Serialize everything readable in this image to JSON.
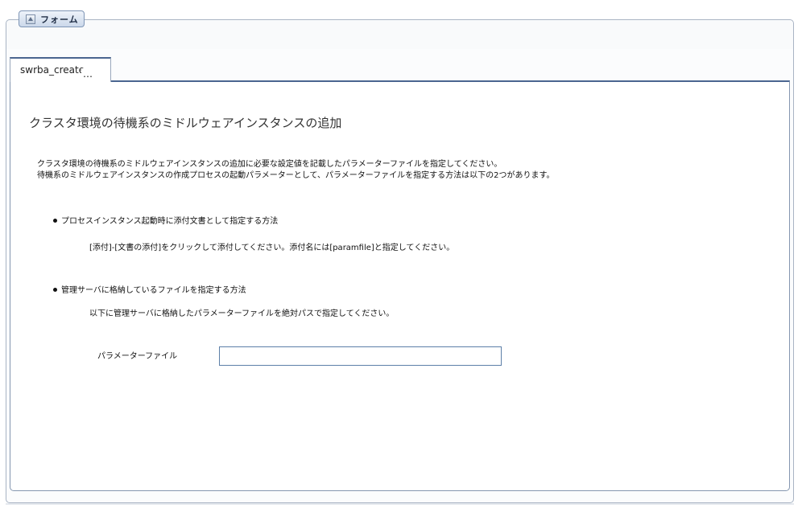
{
  "panel": {
    "tab_label": "フォーム"
  },
  "document_tab": {
    "label": "swrba_create",
    "ellipsis": "…"
  },
  "content": {
    "title": "クラスタ環境の待機系のミドルウェアインスタンスの追加",
    "description_line1": "クラスタ環境の待機系のミドルウェアインスタンスの追加に必要な設定値を記載したパラメーターファイルを指定してください。",
    "description_line2": "待機系のミドルウェアインスタンスの作成プロセスの起動パラメーターとして、パラメーターファイルを指定する方法は以下の2つがあります。",
    "method1": {
      "heading": "プロセスインスタンス起動時に添付文書として指定する方法",
      "detail": "[添付]-[文書の添付]をクリックして添付してください。添付名には[paramfile]と指定してください。"
    },
    "method2": {
      "heading": "管理サーバに格納しているファイルを指定する方法",
      "detail": "以下に管理サーバに格納したパラメーターファイルを絶対パスで指定してください。"
    },
    "param_field": {
      "label": "パラメーターファイル",
      "value": "",
      "placeholder": ""
    }
  },
  "icons": {
    "collapse": "collapse-up-icon"
  }
}
